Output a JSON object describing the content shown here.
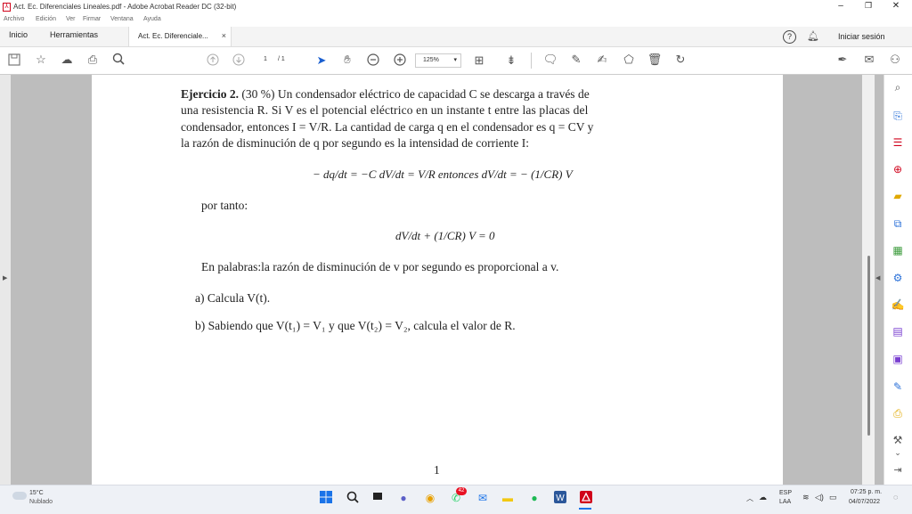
{
  "window": {
    "title": "Act. Ec. Diferenciales Lineales.pdf - Adobe Acrobat Reader DC (32-bit)",
    "controls": {
      "minimize": "–",
      "maximize": "❐",
      "close": "✕"
    }
  },
  "menu": [
    "Archivo",
    "Edición",
    "Ver",
    "Firmar",
    "Ventana",
    "Ayuda"
  ],
  "tabs": {
    "home": "Inicio",
    "tools": "Herramientas",
    "document": "Act. Ec. Diferenciale...",
    "close": "×"
  },
  "account": {
    "help": "?",
    "sign_in": "Iniciar sesión"
  },
  "toolbar": {
    "page_current": "1",
    "page_total": "/ 1",
    "zoom": "125%"
  },
  "document": {
    "heading": "Ejercicio 2.",
    "line1": " (30 %) Un condensador eléctrico de capacidad C se descarga a través de",
    "line2": "una resistencia R.  Si V es el potencial eléctrico en un instante t entre las placas del",
    "line3": "condensador, entonces I = V/R. La cantidad de carga q en el condensador es q = CV y",
    "line4": "la razón de disminución de q por segundo es la intensidad de corriente I:",
    "eq1": "− dq/dt = −C dV/dt = V/R entonces dV/dt = − (1/CR) V",
    "por_tanto": "por tanto:",
    "eq2": "dV/dt + (1/CR) V = 0",
    "en_palabras": "En palabras:la razón de disminución de v por segundo es proporcional a v.",
    "item_a": "a)  Calcula V(t).",
    "item_b": "b)  Sabiendo que V(t₁) = V₁ y que V(t₂) = V₂, calcula el valor de R.",
    "page_number": "1"
  },
  "taskbar": {
    "weather_temp": "15°C",
    "weather_desc": "Nublado",
    "notification_badge": "42",
    "lang1": "ESP",
    "lang2": "LAA",
    "time": "07:25 p. m.",
    "date": "04/07/2022"
  }
}
